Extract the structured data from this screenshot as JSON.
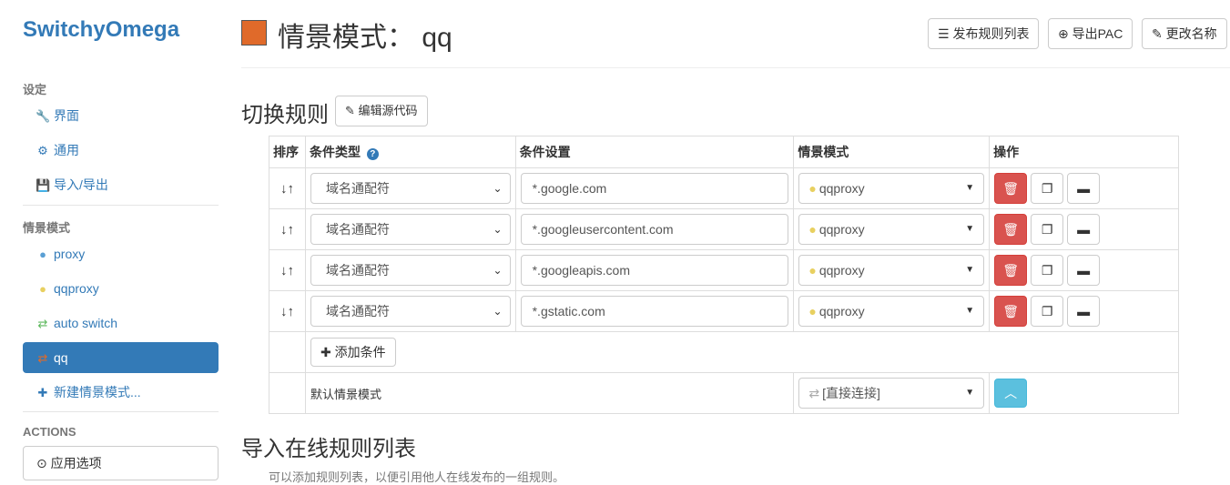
{
  "app": {
    "brand": "SwitchyOmega"
  },
  "sidebar": {
    "settings_header": "设定",
    "settings_items": [
      {
        "label": "界面",
        "icon": "wrench-icon"
      },
      {
        "label": "通用",
        "icon": "gear-icon"
      },
      {
        "label": "导入/导出",
        "icon": "floppy-icon"
      }
    ],
    "profiles_header": "情景模式",
    "profile_items": [
      {
        "label": "proxy",
        "icon": "globe-icon"
      },
      {
        "label": "qqproxy",
        "icon": "globe-icon"
      },
      {
        "label": "auto switch",
        "icon": "switch-icon"
      },
      {
        "label": "qq",
        "icon": "switch-icon",
        "active": true
      },
      {
        "label": "新建情景模式...",
        "icon": "plus-icon"
      }
    ],
    "actions_header": "ACTIONS",
    "apply_label": "应用选项"
  },
  "header": {
    "title": "情景模式： qq",
    "swatch_color": "#e06a2a",
    "buttons": [
      "发布规则列表",
      "导出PAC",
      "更改名称"
    ]
  },
  "rules": {
    "title": "切换规则",
    "edit_source_label": "编辑源代码",
    "columns": [
      "排序",
      "条件类型",
      "条件设置",
      "情景模式",
      "操作"
    ],
    "rows": [
      {
        "type": "域名通配符",
        "pattern": "*.google.com",
        "profile": "qqproxy"
      },
      {
        "type": "域名通配符",
        "pattern": "*.googleusercontent.com",
        "profile": "qqproxy"
      },
      {
        "type": "域名通配符",
        "pattern": "*.googleapis.com",
        "profile": "qqproxy"
      },
      {
        "type": "域名通配符",
        "pattern": "*.gstatic.com",
        "profile": "qqproxy"
      }
    ],
    "add_condition_label": "添加条件",
    "default_label": "默认情景模式",
    "default_profile": "[直接连接]"
  },
  "import": {
    "title": "导入在线规则列表",
    "description": "可以添加规则列表，以便引用他人在线发布的一组规则。"
  }
}
